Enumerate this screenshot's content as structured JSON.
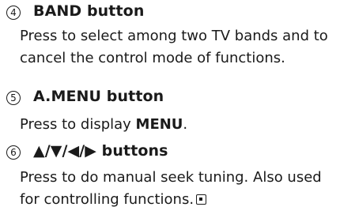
{
  "items": [
    {
      "number": "4",
      "title": "BAND button",
      "lines": [
        "Press to select among two TV bands and to",
        "cancel the control mode of functions."
      ]
    },
    {
      "number": "5",
      "title": "A.MENU button",
      "line_prefix": "Press to display ",
      "line_bold": "MENU",
      "line_suffix": "."
    },
    {
      "number": "6",
      "title": "▲/▼/◀/▶ buttons",
      "lines": [
        "Press to do manual seek tuning. Also used",
        "for controlling functions."
      ],
      "end_icon": "end-of-section-icon"
    }
  ]
}
